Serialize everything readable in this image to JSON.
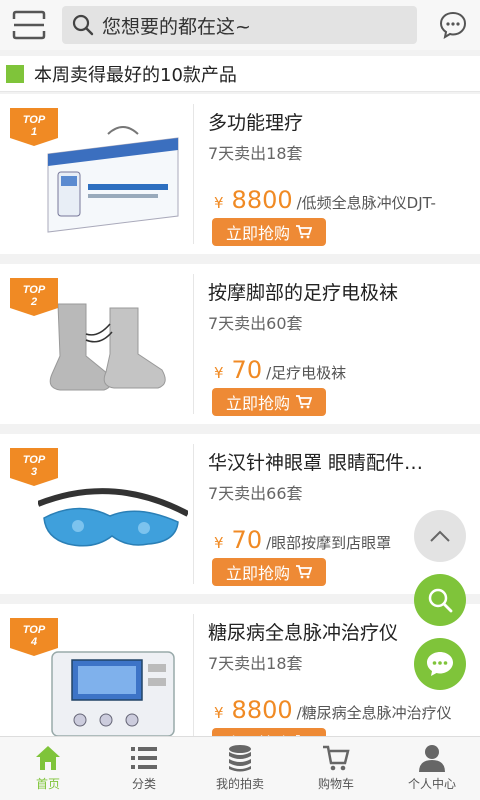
{
  "header": {
    "search_placeholder": "您想要的都在这~"
  },
  "section": {
    "title": "本周卖得最好的10款产品"
  },
  "buy_label": "立即抢购",
  "currency": "¥",
  "products": [
    {
      "badge": "TOP",
      "rank": "1",
      "name": "多功能理疗",
      "sold": "7天卖出18套",
      "price": "8800",
      "desc": "/低频全息脉冲仪DJT-"
    },
    {
      "badge": "TOP",
      "rank": "2",
      "name": "按摩脚部的足疗电极袜",
      "sold": "7天卖出60套",
      "price": "70",
      "desc": "/足疗电极袜"
    },
    {
      "badge": "TOP",
      "rank": "3",
      "name": "华汉针神眼罩 眼睛配件…",
      "sold": "7天卖出66套",
      "price": "70",
      "desc": "/眼部按摩到店眼罩"
    },
    {
      "badge": "TOP",
      "rank": "4",
      "name": "糖尿病全息脉冲治疗仪",
      "sold": "7天卖出18套",
      "price": "8800",
      "desc": "/糖尿病全息脉冲治疗仪"
    }
  ],
  "tabs": [
    {
      "label": "首页",
      "icon": "home-icon"
    },
    {
      "label": "分类",
      "icon": "list-icon"
    },
    {
      "label": "我的拍卖",
      "icon": "coins-icon"
    },
    {
      "label": "购物车",
      "icon": "cart-icon"
    },
    {
      "label": "个人中心",
      "icon": "user-icon"
    }
  ],
  "colors": {
    "accent_green": "#7fc43a",
    "accent_orange": "#ee8a35",
    "price_orange": "#f08a24"
  }
}
